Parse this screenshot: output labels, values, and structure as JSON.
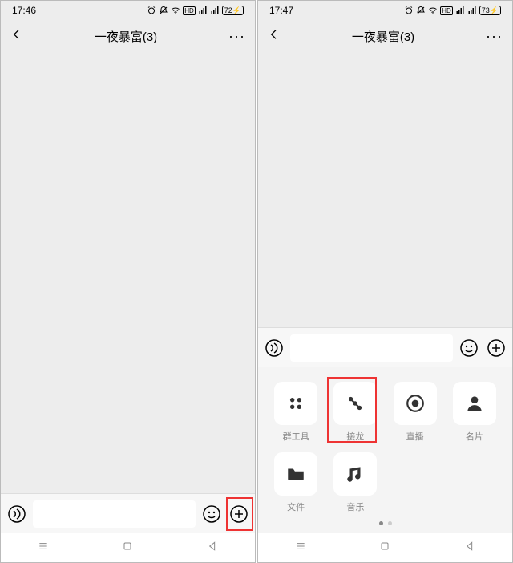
{
  "left": {
    "status": {
      "time": "17:46",
      "battery": "72"
    },
    "title": "一夜暴富(3)"
  },
  "right": {
    "status": {
      "time": "17:47",
      "battery": "73"
    },
    "title": "一夜暴富(3)",
    "attachments": [
      {
        "label": "群工具"
      },
      {
        "label": "接龙"
      },
      {
        "label": "直播"
      },
      {
        "label": "名片"
      },
      {
        "label": "文件"
      },
      {
        "label": "音乐"
      }
    ]
  }
}
